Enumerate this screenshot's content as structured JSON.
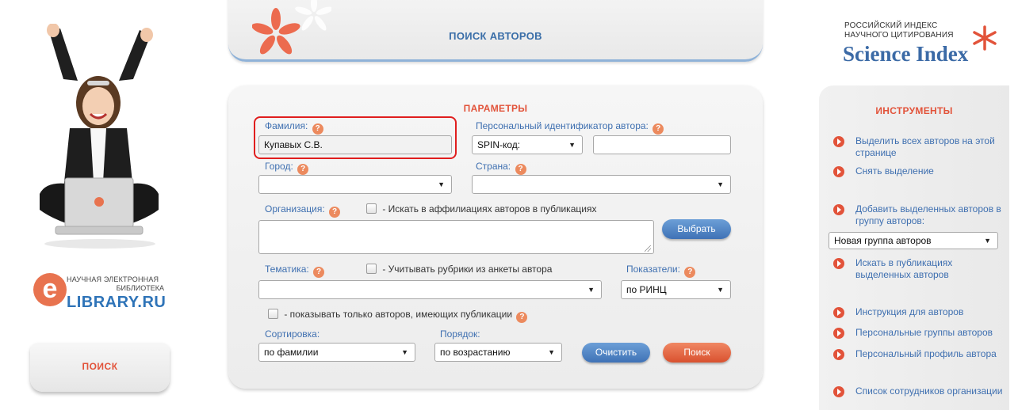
{
  "header": {
    "title": "ПОИСК АВТОРОВ"
  },
  "brand": {
    "science_index_small_1": "РОССИЙСКИЙ ИНДЕКС",
    "science_index_small_2": "НАУЧНОГО ЦИТИРОВАНИЯ",
    "science_index_big": "Science Index",
    "elibrary_line1": "НАУЧНАЯ ЭЛЕКТРОННАЯ",
    "elibrary_line2": "БИБЛИОТЕКА",
    "elibrary_main": "LIBRARY.RU",
    "elibrary_e": "e"
  },
  "left_nav": {
    "search_label": "ПОИСК"
  },
  "form": {
    "title": "ПАРАМЕТРЫ",
    "help_glyph": "?",
    "surname": {
      "label": "Фамилия:",
      "value": "Купавых С.В."
    },
    "author_id": {
      "label": "Персональный идентификатор автора:",
      "type_value": "SPIN-код:",
      "value": ""
    },
    "city": {
      "label": "Город:",
      "value": ""
    },
    "country": {
      "label": "Страна:",
      "value": ""
    },
    "organization": {
      "label": "Организация:",
      "checkbox_label": "- Искать в аффилиациях авторов в публикациях",
      "value": ""
    },
    "select_button": "Выбрать",
    "topic": {
      "label": "Тематика:",
      "checkbox_label": "- Учитывать рубрики из анкеты автора",
      "value": ""
    },
    "indicators": {
      "label": "Показатели:",
      "value": "по РИНЦ"
    },
    "only_with_pubs_label": "- показывать только авторов, имеющих публикации",
    "sort": {
      "label": "Сортировка:",
      "value": "по фамилии"
    },
    "order": {
      "label": "Порядок:",
      "value": "по возрастанию"
    },
    "clear_button": "Очистить",
    "search_button": "Поиск",
    "arrow_glyph": "▼"
  },
  "tools": {
    "title": "ИНСТРУМЕНТЫ",
    "select_all": "Выделить всех авторов на этой странице",
    "deselect": "Снять выделение",
    "add_to_group": "Добавить выделенных авторов в группу авторов:",
    "group_select_value": "Новая группа авторов",
    "search_in_pubs": "Искать в публикациях выделенных авторов",
    "instructions": "Инструкция для авторов",
    "personal_groups": "Персональные группы авторов",
    "personal_profile": "Персональный профиль автора",
    "staff_list": "Список сотрудников организации"
  },
  "colors": {
    "accent_red": "#e2533a",
    "link_blue": "#3e6fb0",
    "button_blue": "#4a7fc0",
    "highlight": "#e01e1e"
  }
}
